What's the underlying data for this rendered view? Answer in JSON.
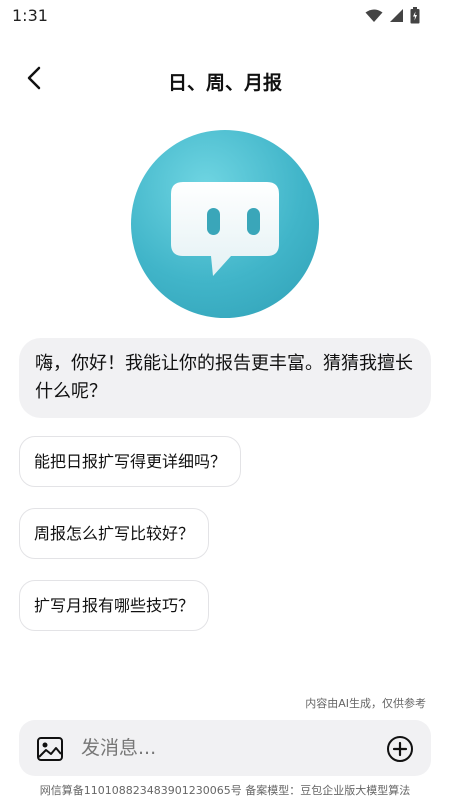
{
  "status_bar": {
    "time": "1:31",
    "icons": [
      "wifi-icon",
      "signal-icon",
      "battery-icon"
    ]
  },
  "header": {
    "title": "日、周、月报",
    "back_icon": "chevron-left-icon"
  },
  "avatar": {
    "icon": "chat-bubble-bot-icon",
    "color": "#41b5c9"
  },
  "greeting": {
    "text": "嗨，你好！我能让你的报告更丰富。猜猜我擅长什么呢？"
  },
  "suggestions": [
    {
      "label": "能把日报扩写得更详细吗？"
    },
    {
      "label": "周报怎么扩写比较好？"
    },
    {
      "label": "扩写月报有哪些技巧？"
    }
  ],
  "disclaimer": "内容由AI生成，仅供参考",
  "input": {
    "placeholder": "发消息...",
    "left_icon": "image-icon",
    "right_icon": "plus-circle-icon"
  },
  "footer": {
    "text": "网信算备110108823483901230065号 备案模型：豆包企业版大模型算法"
  }
}
